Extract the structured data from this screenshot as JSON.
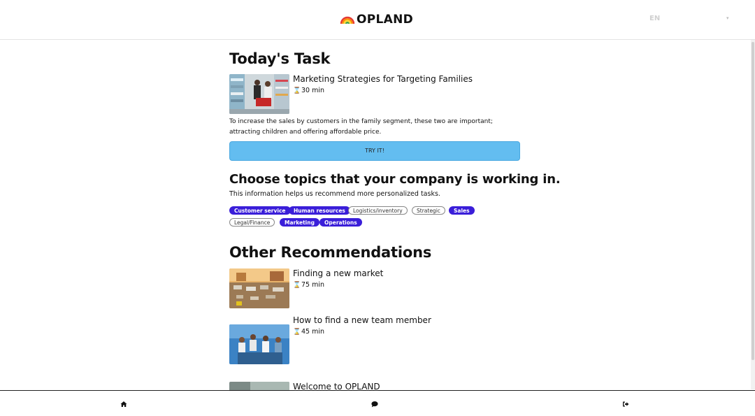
{
  "header": {
    "brand": "OPLAND",
    "brand_icon": "rainbow-icon",
    "language": "EN",
    "language_caret": "▾"
  },
  "today": {
    "heading": "Today's Task",
    "task": {
      "title": "Marketing Strategies for Targeting Families",
      "duration": "30 min",
      "image": "family-shopping-photo"
    },
    "description_line1": "To increase the sales by customers in the family segment, these two are important;",
    "description_line2": "attracting children and offering affordable price.",
    "button_label": "TRY IT!"
  },
  "topics": {
    "heading": "Choose topics that your company is working in.",
    "subtitle": "This information helps us recommend more personalized tasks.",
    "items": [
      {
        "label": "Customer service",
        "selected": true
      },
      {
        "label": "Human resources",
        "selected": true
      },
      {
        "label": "Logistics/inventory",
        "selected": false
      },
      {
        "label": "Strategic",
        "selected": false
      },
      {
        "label": "Sales",
        "selected": true
      },
      {
        "label": "Legal/Finance",
        "selected": false
      },
      {
        "label": "Marketing",
        "selected": true
      },
      {
        "label": "Operations",
        "selected": true
      }
    ]
  },
  "other": {
    "heading": "Other Recommendations",
    "items": [
      {
        "title": "Finding a new market",
        "duration": "75 min",
        "image": "market-square-photo"
      },
      {
        "title": "How to find a new team member",
        "duration": "45 min",
        "image": "team-celebration-photo"
      },
      {
        "title": "Welcome to OPLAND",
        "duration": "",
        "image": "welcome-photo"
      }
    ]
  },
  "footer": {
    "icons": [
      "home-icon",
      "chat-icon",
      "logout-icon"
    ]
  },
  "colors": {
    "accent_button": "#63bdf0",
    "chip_selected": "#3a1ed9"
  }
}
